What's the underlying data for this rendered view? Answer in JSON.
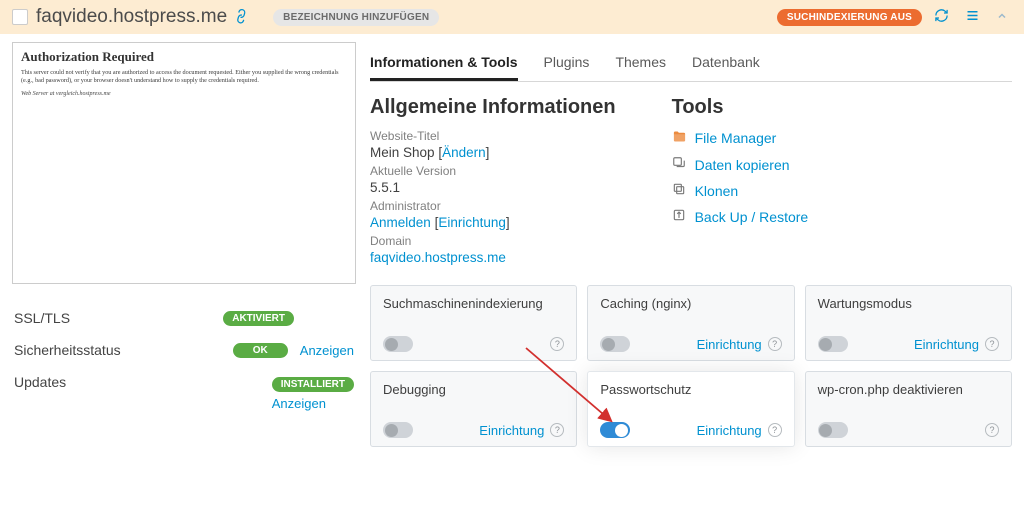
{
  "header": {
    "domain": "faqvideo.hostpress.me",
    "add_label": "BEZEICHNUNG HINZUFÜGEN",
    "index_badge": "SUCHINDEXIERUNG AUS"
  },
  "preview": {
    "title": "Authorization Required",
    "body": "This server could not verify that you are authorized to access the document requested. Either you supplied the wrong credentials (e.g., bad password), or your browser doesn't understand how to supply the credentials required.",
    "server": "Web Server at vergleich.hostpress.me"
  },
  "status": {
    "ssl": {
      "label": "SSL/TLS",
      "pill": "AKTIVIERT"
    },
    "security": {
      "label": "Sicherheitsstatus",
      "pill": "OK",
      "link": "Anzeigen"
    },
    "updates": {
      "label": "Updates",
      "pill": "INSTALLIERT",
      "link": "Anzeigen"
    }
  },
  "tabs": [
    "Informationen & Tools",
    "Plugins",
    "Themes",
    "Datenbank"
  ],
  "info": {
    "heading": "Allgemeine Informationen",
    "site_title_label": "Website-Titel",
    "site_title": "Mein Shop",
    "change": "Ändern",
    "version_label": "Aktuelle Version",
    "version": "5.5.1",
    "admin_label": "Administrator",
    "login": "Anmelden",
    "setup": "Einrichtung",
    "domain_label": "Domain",
    "domain": "faqvideo.hostpress.me"
  },
  "tools": {
    "heading": "Tools",
    "items": [
      "File Manager",
      "Daten kopieren",
      "Klonen",
      "Back Up / Restore"
    ]
  },
  "tiles": {
    "setup_label": "Einrichtung",
    "seo": {
      "title": "Suchmaschinenindexierung",
      "on": false,
      "show_setup": false
    },
    "caching": {
      "title": "Caching (nginx)",
      "on": false,
      "show_setup": true
    },
    "maint": {
      "title": "Wartungsmodus",
      "on": false,
      "show_setup": true
    },
    "debug": {
      "title": "Debugging",
      "on": false,
      "show_setup": true
    },
    "password": {
      "title": "Passwortschutz",
      "on": true,
      "show_setup": true
    },
    "wpcron": {
      "title": "wp-cron.php deaktivieren",
      "on": false,
      "show_setup": false
    }
  }
}
